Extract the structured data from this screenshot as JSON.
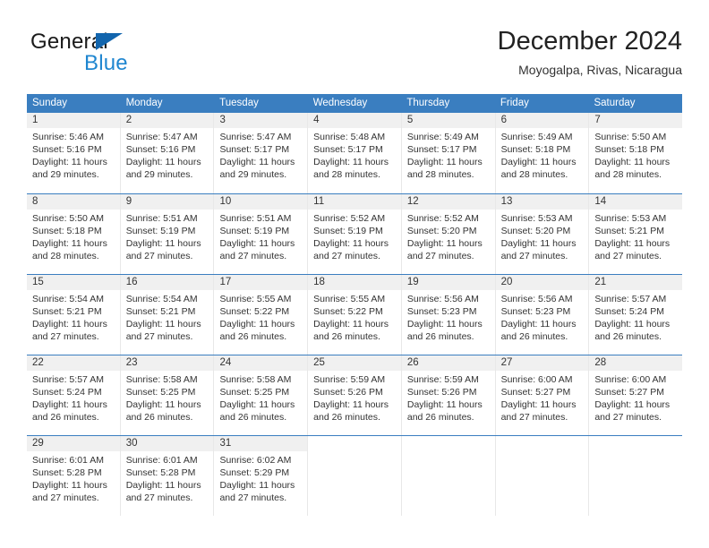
{
  "brand": {
    "name_top": "General",
    "name_bottom": "Blue",
    "accent_color": "#1265ad",
    "blue_text_color": "#1f86d0"
  },
  "header": {
    "title": "December 2024",
    "subtitle": "Moyogalpa, Rivas, Nicaragua"
  },
  "theme": {
    "header_band": "#3a7ec0",
    "day_number_band": "#f0f0f0",
    "grid_line": "#e8e8e8",
    "text": "#333333"
  },
  "weekdays": [
    "Sunday",
    "Monday",
    "Tuesday",
    "Wednesday",
    "Thursday",
    "Friday",
    "Saturday"
  ],
  "weeks": [
    [
      {
        "day": "1",
        "sunrise": "Sunrise: 5:46 AM",
        "sunset": "Sunset: 5:16 PM",
        "daylight1": "Daylight: 11 hours",
        "daylight2": "and 29 minutes."
      },
      {
        "day": "2",
        "sunrise": "Sunrise: 5:47 AM",
        "sunset": "Sunset: 5:16 PM",
        "daylight1": "Daylight: 11 hours",
        "daylight2": "and 29 minutes."
      },
      {
        "day": "3",
        "sunrise": "Sunrise: 5:47 AM",
        "sunset": "Sunset: 5:17 PM",
        "daylight1": "Daylight: 11 hours",
        "daylight2": "and 29 minutes."
      },
      {
        "day": "4",
        "sunrise": "Sunrise: 5:48 AM",
        "sunset": "Sunset: 5:17 PM",
        "daylight1": "Daylight: 11 hours",
        "daylight2": "and 28 minutes."
      },
      {
        "day": "5",
        "sunrise": "Sunrise: 5:49 AM",
        "sunset": "Sunset: 5:17 PM",
        "daylight1": "Daylight: 11 hours",
        "daylight2": "and 28 minutes."
      },
      {
        "day": "6",
        "sunrise": "Sunrise: 5:49 AM",
        "sunset": "Sunset: 5:18 PM",
        "daylight1": "Daylight: 11 hours",
        "daylight2": "and 28 minutes."
      },
      {
        "day": "7",
        "sunrise": "Sunrise: 5:50 AM",
        "sunset": "Sunset: 5:18 PM",
        "daylight1": "Daylight: 11 hours",
        "daylight2": "and 28 minutes."
      }
    ],
    [
      {
        "day": "8",
        "sunrise": "Sunrise: 5:50 AM",
        "sunset": "Sunset: 5:18 PM",
        "daylight1": "Daylight: 11 hours",
        "daylight2": "and 28 minutes."
      },
      {
        "day": "9",
        "sunrise": "Sunrise: 5:51 AM",
        "sunset": "Sunset: 5:19 PM",
        "daylight1": "Daylight: 11 hours",
        "daylight2": "and 27 minutes."
      },
      {
        "day": "10",
        "sunrise": "Sunrise: 5:51 AM",
        "sunset": "Sunset: 5:19 PM",
        "daylight1": "Daylight: 11 hours",
        "daylight2": "and 27 minutes."
      },
      {
        "day": "11",
        "sunrise": "Sunrise: 5:52 AM",
        "sunset": "Sunset: 5:19 PM",
        "daylight1": "Daylight: 11 hours",
        "daylight2": "and 27 minutes."
      },
      {
        "day": "12",
        "sunrise": "Sunrise: 5:52 AM",
        "sunset": "Sunset: 5:20 PM",
        "daylight1": "Daylight: 11 hours",
        "daylight2": "and 27 minutes."
      },
      {
        "day": "13",
        "sunrise": "Sunrise: 5:53 AM",
        "sunset": "Sunset: 5:20 PM",
        "daylight1": "Daylight: 11 hours",
        "daylight2": "and 27 minutes."
      },
      {
        "day": "14",
        "sunrise": "Sunrise: 5:53 AM",
        "sunset": "Sunset: 5:21 PM",
        "daylight1": "Daylight: 11 hours",
        "daylight2": "and 27 minutes."
      }
    ],
    [
      {
        "day": "15",
        "sunrise": "Sunrise: 5:54 AM",
        "sunset": "Sunset: 5:21 PM",
        "daylight1": "Daylight: 11 hours",
        "daylight2": "and 27 minutes."
      },
      {
        "day": "16",
        "sunrise": "Sunrise: 5:54 AM",
        "sunset": "Sunset: 5:21 PM",
        "daylight1": "Daylight: 11 hours",
        "daylight2": "and 27 minutes."
      },
      {
        "day": "17",
        "sunrise": "Sunrise: 5:55 AM",
        "sunset": "Sunset: 5:22 PM",
        "daylight1": "Daylight: 11 hours",
        "daylight2": "and 26 minutes."
      },
      {
        "day": "18",
        "sunrise": "Sunrise: 5:55 AM",
        "sunset": "Sunset: 5:22 PM",
        "daylight1": "Daylight: 11 hours",
        "daylight2": "and 26 minutes."
      },
      {
        "day": "19",
        "sunrise": "Sunrise: 5:56 AM",
        "sunset": "Sunset: 5:23 PM",
        "daylight1": "Daylight: 11 hours",
        "daylight2": "and 26 minutes."
      },
      {
        "day": "20",
        "sunrise": "Sunrise: 5:56 AM",
        "sunset": "Sunset: 5:23 PM",
        "daylight1": "Daylight: 11 hours",
        "daylight2": "and 26 minutes."
      },
      {
        "day": "21",
        "sunrise": "Sunrise: 5:57 AM",
        "sunset": "Sunset: 5:24 PM",
        "daylight1": "Daylight: 11 hours",
        "daylight2": "and 26 minutes."
      }
    ],
    [
      {
        "day": "22",
        "sunrise": "Sunrise: 5:57 AM",
        "sunset": "Sunset: 5:24 PM",
        "daylight1": "Daylight: 11 hours",
        "daylight2": "and 26 minutes."
      },
      {
        "day": "23",
        "sunrise": "Sunrise: 5:58 AM",
        "sunset": "Sunset: 5:25 PM",
        "daylight1": "Daylight: 11 hours",
        "daylight2": "and 26 minutes."
      },
      {
        "day": "24",
        "sunrise": "Sunrise: 5:58 AM",
        "sunset": "Sunset: 5:25 PM",
        "daylight1": "Daylight: 11 hours",
        "daylight2": "and 26 minutes."
      },
      {
        "day": "25",
        "sunrise": "Sunrise: 5:59 AM",
        "sunset": "Sunset: 5:26 PM",
        "daylight1": "Daylight: 11 hours",
        "daylight2": "and 26 minutes."
      },
      {
        "day": "26",
        "sunrise": "Sunrise: 5:59 AM",
        "sunset": "Sunset: 5:26 PM",
        "daylight1": "Daylight: 11 hours",
        "daylight2": "and 26 minutes."
      },
      {
        "day": "27",
        "sunrise": "Sunrise: 6:00 AM",
        "sunset": "Sunset: 5:27 PM",
        "daylight1": "Daylight: 11 hours",
        "daylight2": "and 27 minutes."
      },
      {
        "day": "28",
        "sunrise": "Sunrise: 6:00 AM",
        "sunset": "Sunset: 5:27 PM",
        "daylight1": "Daylight: 11 hours",
        "daylight2": "and 27 minutes."
      }
    ],
    [
      {
        "day": "29",
        "sunrise": "Sunrise: 6:01 AM",
        "sunset": "Sunset: 5:28 PM",
        "daylight1": "Daylight: 11 hours",
        "daylight2": "and 27 minutes."
      },
      {
        "day": "30",
        "sunrise": "Sunrise: 6:01 AM",
        "sunset": "Sunset: 5:28 PM",
        "daylight1": "Daylight: 11 hours",
        "daylight2": "and 27 minutes."
      },
      {
        "day": "31",
        "sunrise": "Sunrise: 6:02 AM",
        "sunset": "Sunset: 5:29 PM",
        "daylight1": "Daylight: 11 hours",
        "daylight2": "and 27 minutes."
      },
      {
        "day": "",
        "sunrise": "",
        "sunset": "",
        "daylight1": "",
        "daylight2": ""
      },
      {
        "day": "",
        "sunrise": "",
        "sunset": "",
        "daylight1": "",
        "daylight2": ""
      },
      {
        "day": "",
        "sunrise": "",
        "sunset": "",
        "daylight1": "",
        "daylight2": ""
      },
      {
        "day": "",
        "sunrise": "",
        "sunset": "",
        "daylight1": "",
        "daylight2": ""
      }
    ]
  ]
}
